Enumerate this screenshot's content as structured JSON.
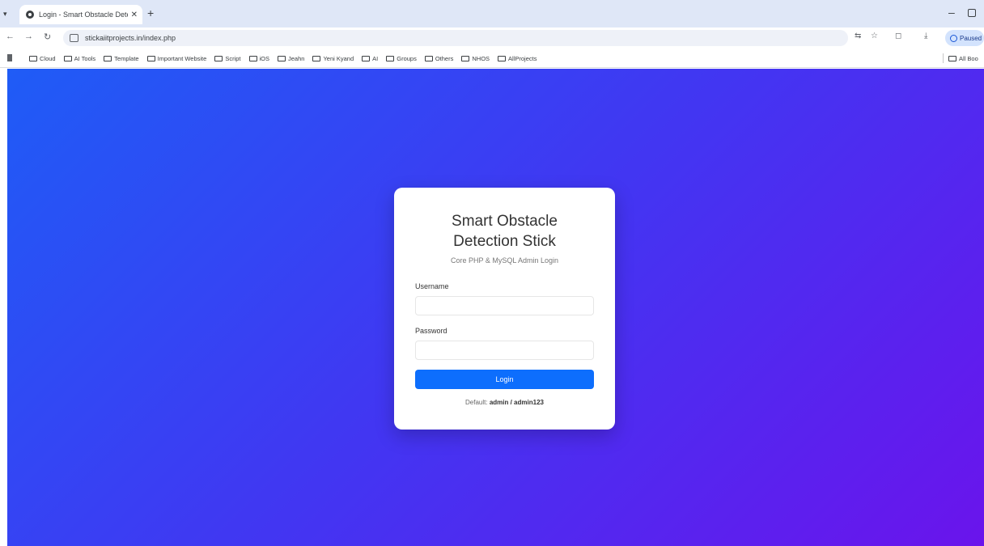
{
  "browser": {
    "tab_title": "Login - Smart Obstacle Detect",
    "url": "stickaiitprojects.in/index.php",
    "profile_label": "Paused",
    "bookmarks": [
      "Cloud",
      "AI Tools",
      "Template",
      "Important Website",
      "Script",
      "iOS",
      "Jeahn",
      "Yeni Kyand",
      "AI",
      "Groups",
      "Others",
      "NHOS",
      "AllProjects"
    ],
    "all_bookmarks_label": "All Boo"
  },
  "login": {
    "title_line1": "Smart Obstacle",
    "title_line2": "Detection Stick",
    "subtitle": "Core PHP & MySQL Admin Login",
    "username_label": "Username",
    "username_value": "",
    "password_label": "Password",
    "password_value": "",
    "button_label": "Login",
    "hint_prefix": "Default:",
    "hint_credentials": "admin / admin123"
  },
  "colors": {
    "gradient_start": "#1f5cf6",
    "gradient_end": "#6a14ec",
    "button": "#0d6efd"
  }
}
